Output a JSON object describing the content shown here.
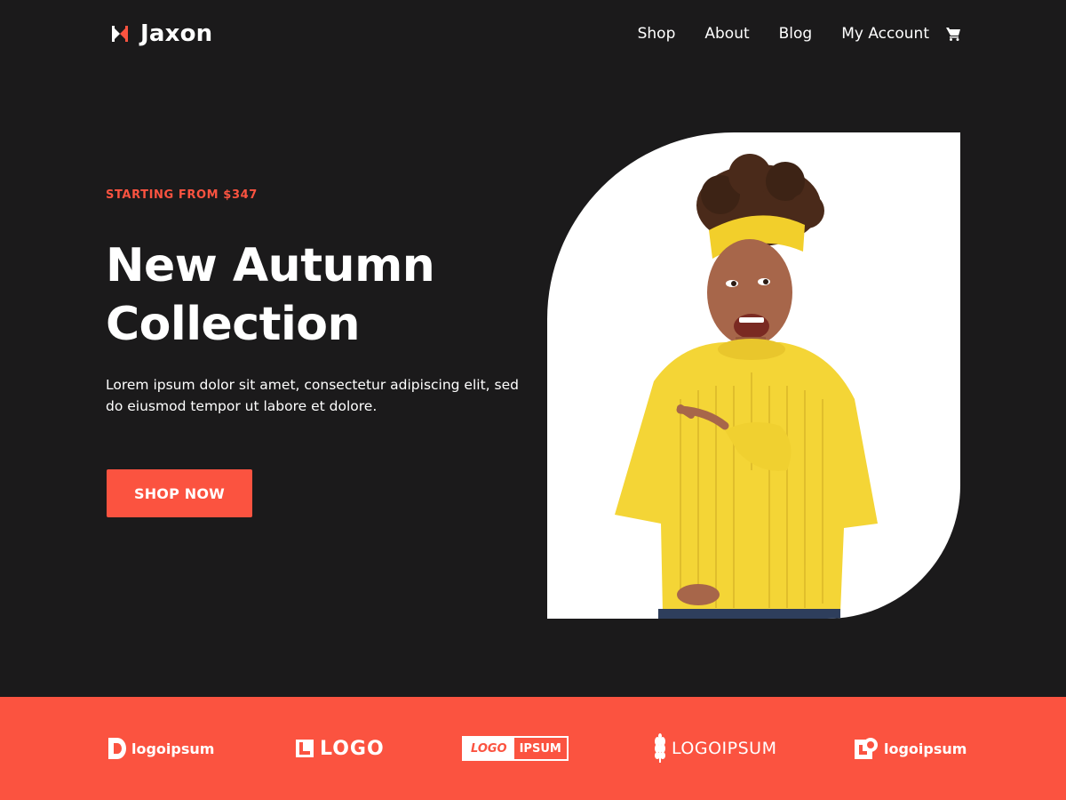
{
  "header": {
    "brand_name": "Jaxon",
    "nav": [
      {
        "label": "Shop"
      },
      {
        "label": "About"
      },
      {
        "label": "Blog"
      },
      {
        "label": "My Account"
      }
    ],
    "cart_icon": "cart-icon"
  },
  "hero": {
    "eyebrow": "STARTING FROM $347",
    "title": "New Autumn Collection",
    "description": "Lorem ipsum dolor sit amet, consectetur adipiscing elit, sed do eiusmod tempor ut labore et dolore.",
    "cta_label": "SHOP NOW",
    "image": "woman-in-yellow-sweater-pointing"
  },
  "brands": {
    "items": [
      {
        "label": "logoipsum",
        "icon": "logoipsum-badge-icon"
      },
      {
        "label": "LOGO",
        "icon": "logo-wordmark"
      },
      {
        "label_left": "LOGO",
        "label_right": "IPSUM"
      },
      {
        "label": "LOGOIPSUM",
        "icon": "wheat-icon"
      },
      {
        "label": "logoipsum",
        "icon": "logoipsum-square-icon"
      }
    ]
  },
  "colors": {
    "background": "#1b1a1b",
    "accent": "#fb5340",
    "text": "#ffffff",
    "panel": "#ffffff"
  }
}
